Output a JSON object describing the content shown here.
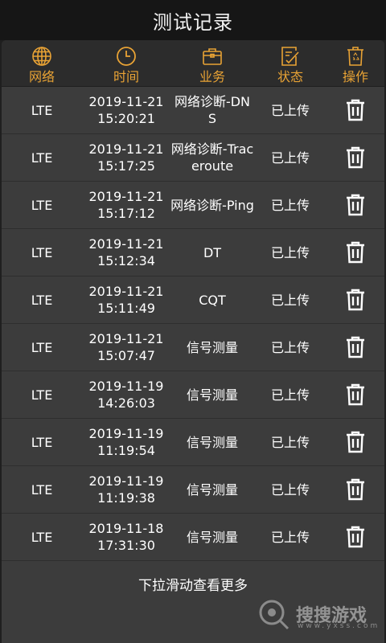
{
  "title": "测试记录",
  "header": {
    "network": "网络",
    "time": "时间",
    "business": "业务",
    "status": "状态",
    "action": "操作",
    "icons": [
      "globe-icon",
      "clock-icon",
      "briefcase-icon",
      "edit-checklist-icon",
      "recycle-bin-icon"
    ]
  },
  "accent_color": "#e9a335",
  "records": [
    {
      "network": "LTE",
      "date": "2019-11-21",
      "time": "15:20:21",
      "business": "网络诊断-DNS",
      "status": "已上传"
    },
    {
      "network": "LTE",
      "date": "2019-11-21",
      "time": "15:17:25",
      "business": "网络诊断-Traceroute",
      "status": "已上传"
    },
    {
      "network": "LTE",
      "date": "2019-11-21",
      "time": "15:17:12",
      "business": "网络诊断-Ping",
      "status": "已上传"
    },
    {
      "network": "LTE",
      "date": "2019-11-21",
      "time": "15:12:34",
      "business": "DT",
      "status": "已上传"
    },
    {
      "network": "LTE",
      "date": "2019-11-21",
      "time": "15:11:49",
      "business": "CQT",
      "status": "已上传"
    },
    {
      "network": "LTE",
      "date": "2019-11-21",
      "time": "15:07:47",
      "business": "信号测量",
      "status": "已上传"
    },
    {
      "network": "LTE",
      "date": "2019-11-19",
      "time": "14:26:03",
      "business": "信号测量",
      "status": "已上传"
    },
    {
      "network": "LTE",
      "date": "2019-11-19",
      "time": "11:19:54",
      "business": "信号测量",
      "status": "已上传"
    },
    {
      "network": "LTE",
      "date": "2019-11-19",
      "time": "11:19:38",
      "business": "信号测量",
      "status": "已上传"
    },
    {
      "network": "LTE",
      "date": "2019-11-18",
      "time": "17:31:30",
      "business": "信号测量",
      "status": "已上传"
    }
  ],
  "footer": "下拉滑动查看更多",
  "watermark": {
    "text": "搜搜游戏",
    "sub": "www.yxss.com"
  }
}
